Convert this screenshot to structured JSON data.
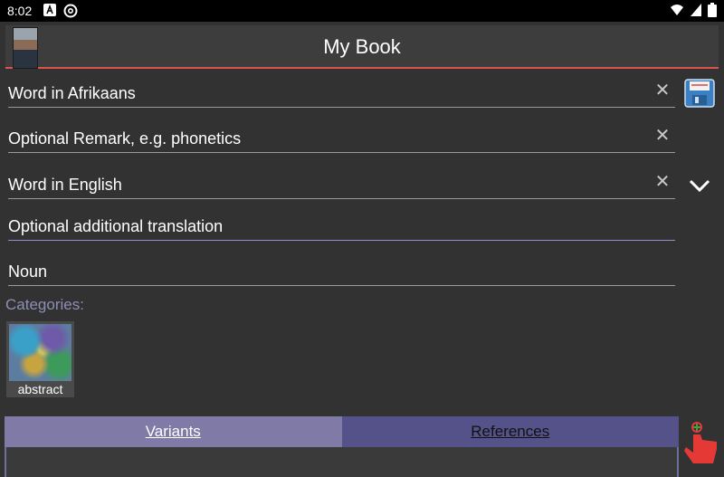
{
  "status": {
    "time": "8:02"
  },
  "appbar": {
    "title": "My Book"
  },
  "fields": {
    "word_af": "Word in Afrikaans",
    "remark": "Optional Remark, e.g. phonetics",
    "word_en": "Word in English",
    "additional": "Optional additional translation",
    "word_type": "Noun"
  },
  "categories": {
    "label": "Categories:",
    "items": [
      {
        "name": "abstract"
      }
    ]
  },
  "tabs": {
    "variants": "Variants",
    "references": "References"
  },
  "icons": {
    "clear": "close-icon",
    "save": "floppy-disk-icon",
    "expand": "chevron-down-icon",
    "add": "hand-plus-icon"
  },
  "colors": {
    "background": "#323232",
    "accent_line": "#d9534f",
    "tab_active": "#7f7ba6",
    "tab_inactive": "#55528a",
    "category_label": "#8e8eb6"
  }
}
